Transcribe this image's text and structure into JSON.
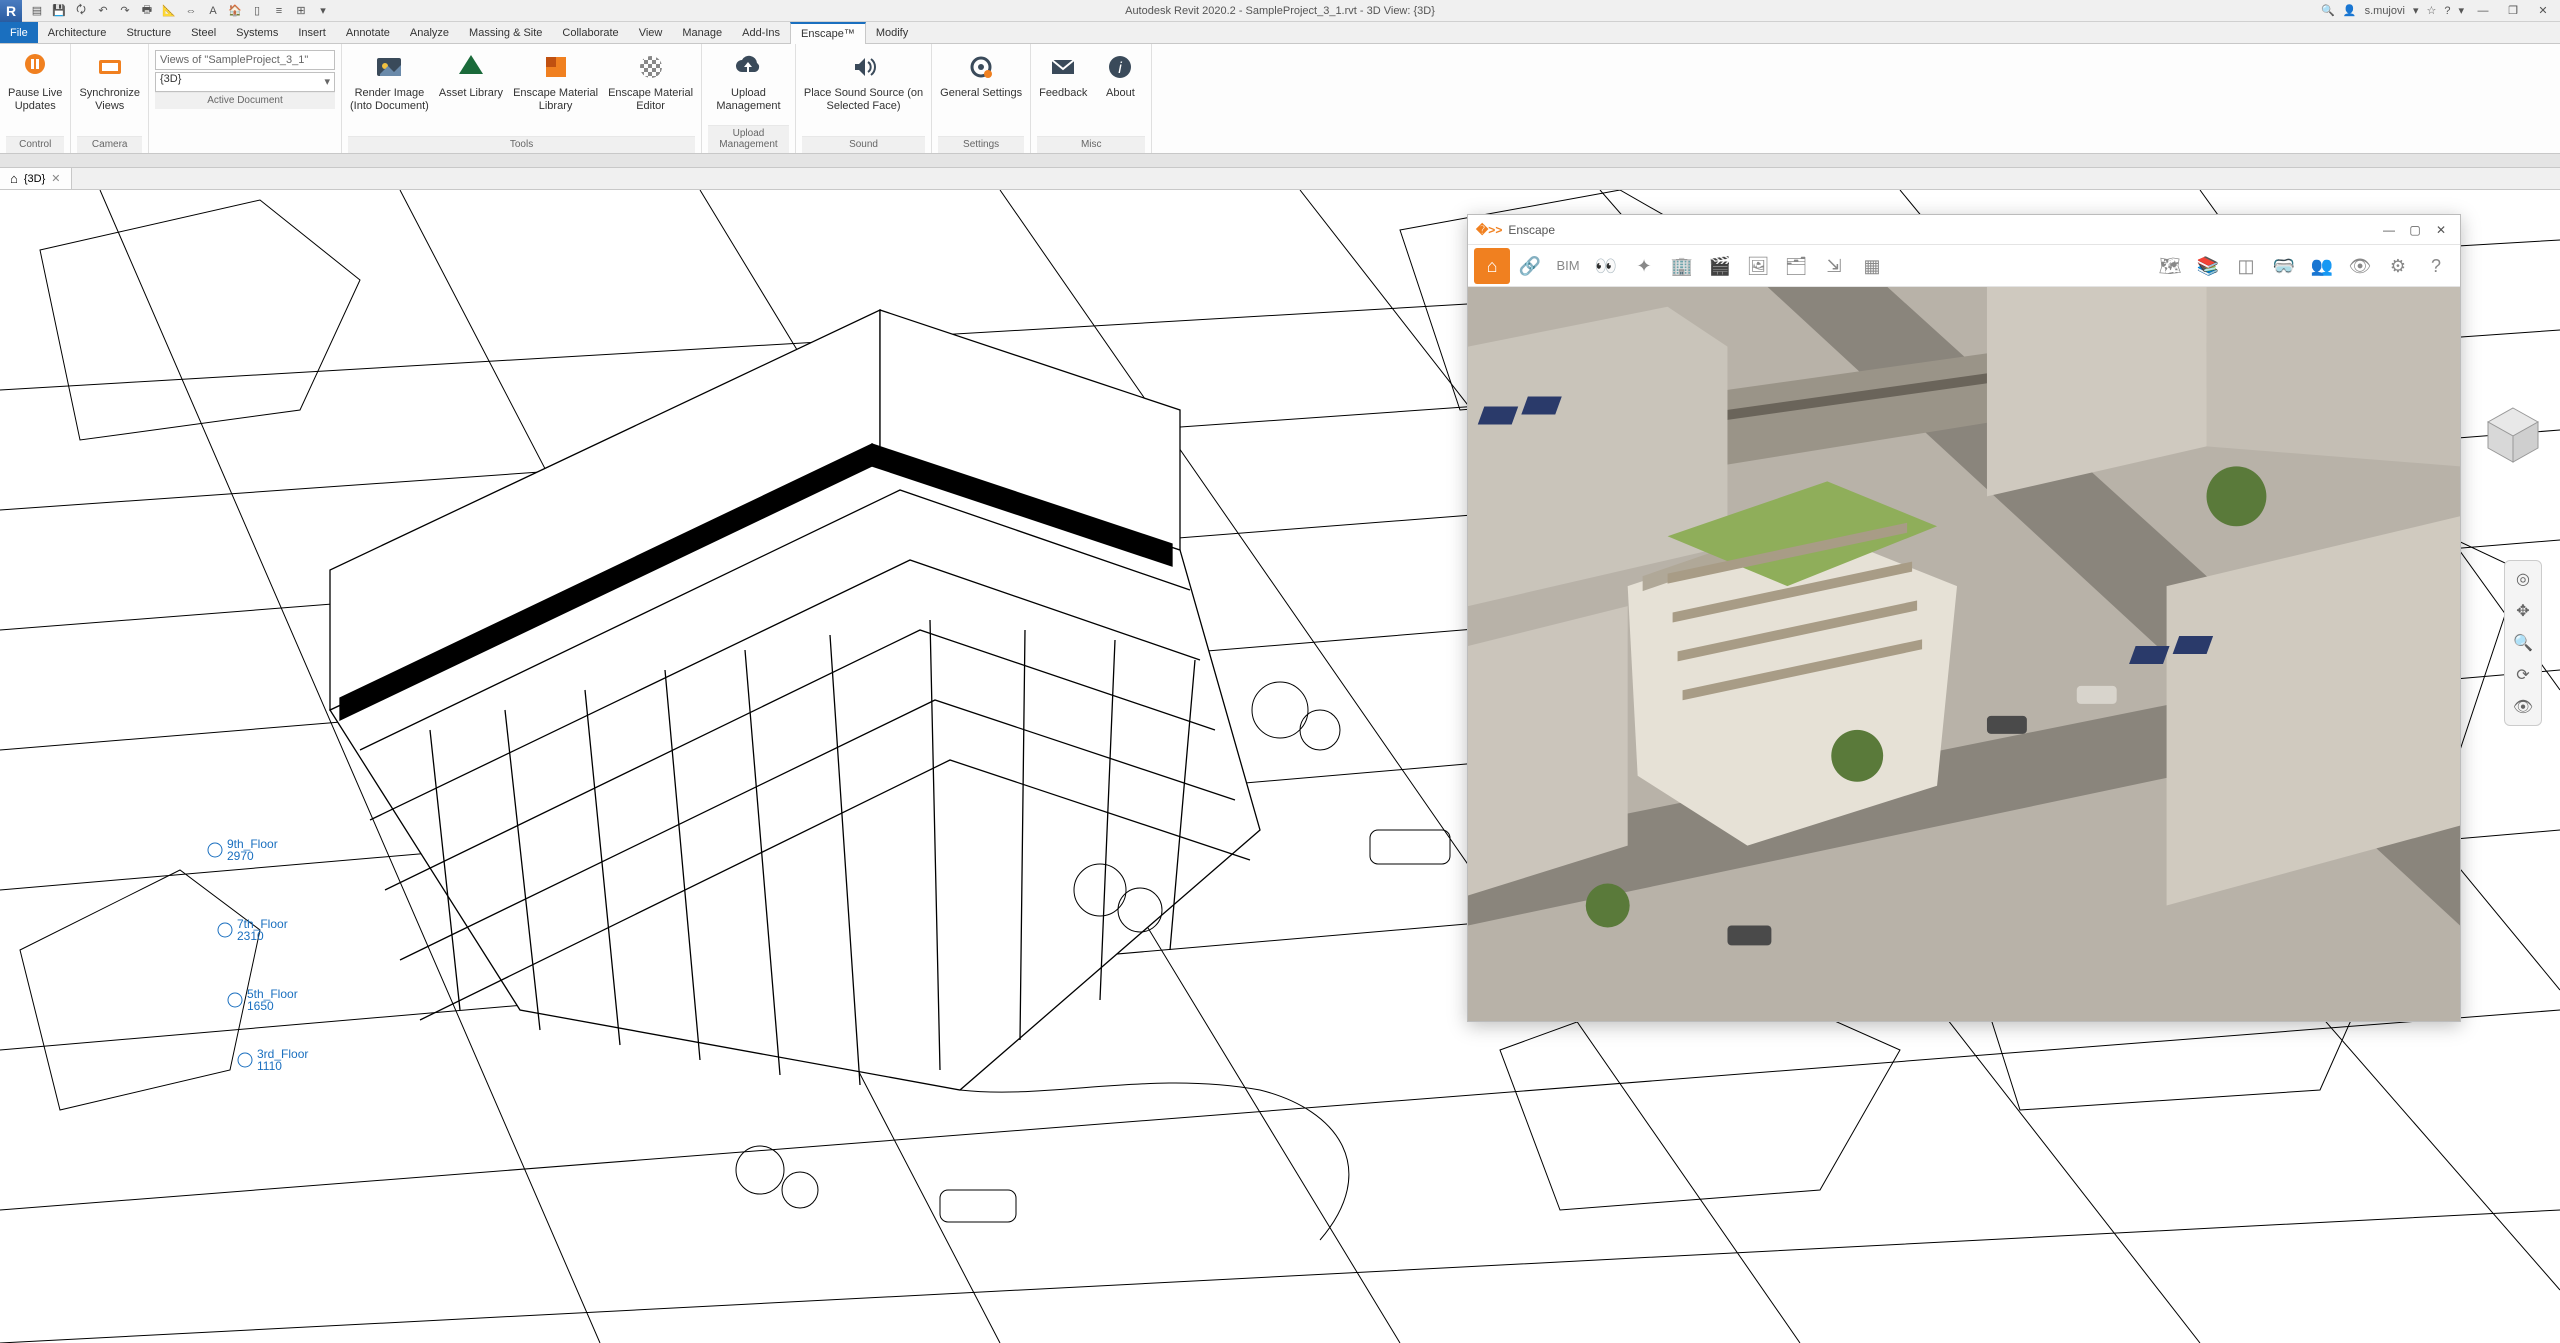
{
  "app_title": "Autodesk Revit 2020.2 - SampleProject_3_1.rvt - 3D View: {3D}",
  "user": "s.mujovi",
  "menu_tabs": [
    "File",
    "Architecture",
    "Structure",
    "Steel",
    "Systems",
    "Insert",
    "Annotate",
    "Analyze",
    "Massing & Site",
    "Collaborate",
    "View",
    "Manage",
    "Add-Ins",
    "Enscape™",
    "Modify"
  ],
  "active_menu_tab": "Enscape™",
  "ribbon": {
    "control": {
      "label": "Control",
      "pause": "Pause Live\nUpdates"
    },
    "camera": {
      "label": "Camera",
      "sync": "Synchronize\nViews"
    },
    "active_doc": {
      "label": "Active Document",
      "views_of": "Views of \"SampleProject_3_1\"",
      "view": "{3D}"
    },
    "tools": {
      "label": "Tools",
      "render": "Render Image\n(Into Document)",
      "asset": "Asset Library",
      "mat_lib": "Enscape Material\nLibrary",
      "mat_ed": "Enscape Material\nEditor"
    },
    "upload": {
      "label": "Upload Management",
      "upload": "Upload\nManagement"
    },
    "sound": {
      "label": "Sound",
      "place": "Place Sound Source (on\nSelected Face)"
    },
    "settings": {
      "label": "Settings",
      "general": "General Settings"
    },
    "misc": {
      "label": "Misc",
      "feedback": "Feedback",
      "about": "About"
    }
  },
  "doc_tab": {
    "icon": "⌂",
    "label": "{3D}"
  },
  "enscape": {
    "title": "Enscape"
  },
  "floor_labels": [
    {
      "name": "9th_Floor",
      "elev": "2970"
    },
    {
      "name": "7th_Floor",
      "elev": "2310"
    },
    {
      "name": "5th_Floor",
      "elev": "1650"
    },
    {
      "name": "3rd_Floor",
      "elev": "1110"
    }
  ]
}
